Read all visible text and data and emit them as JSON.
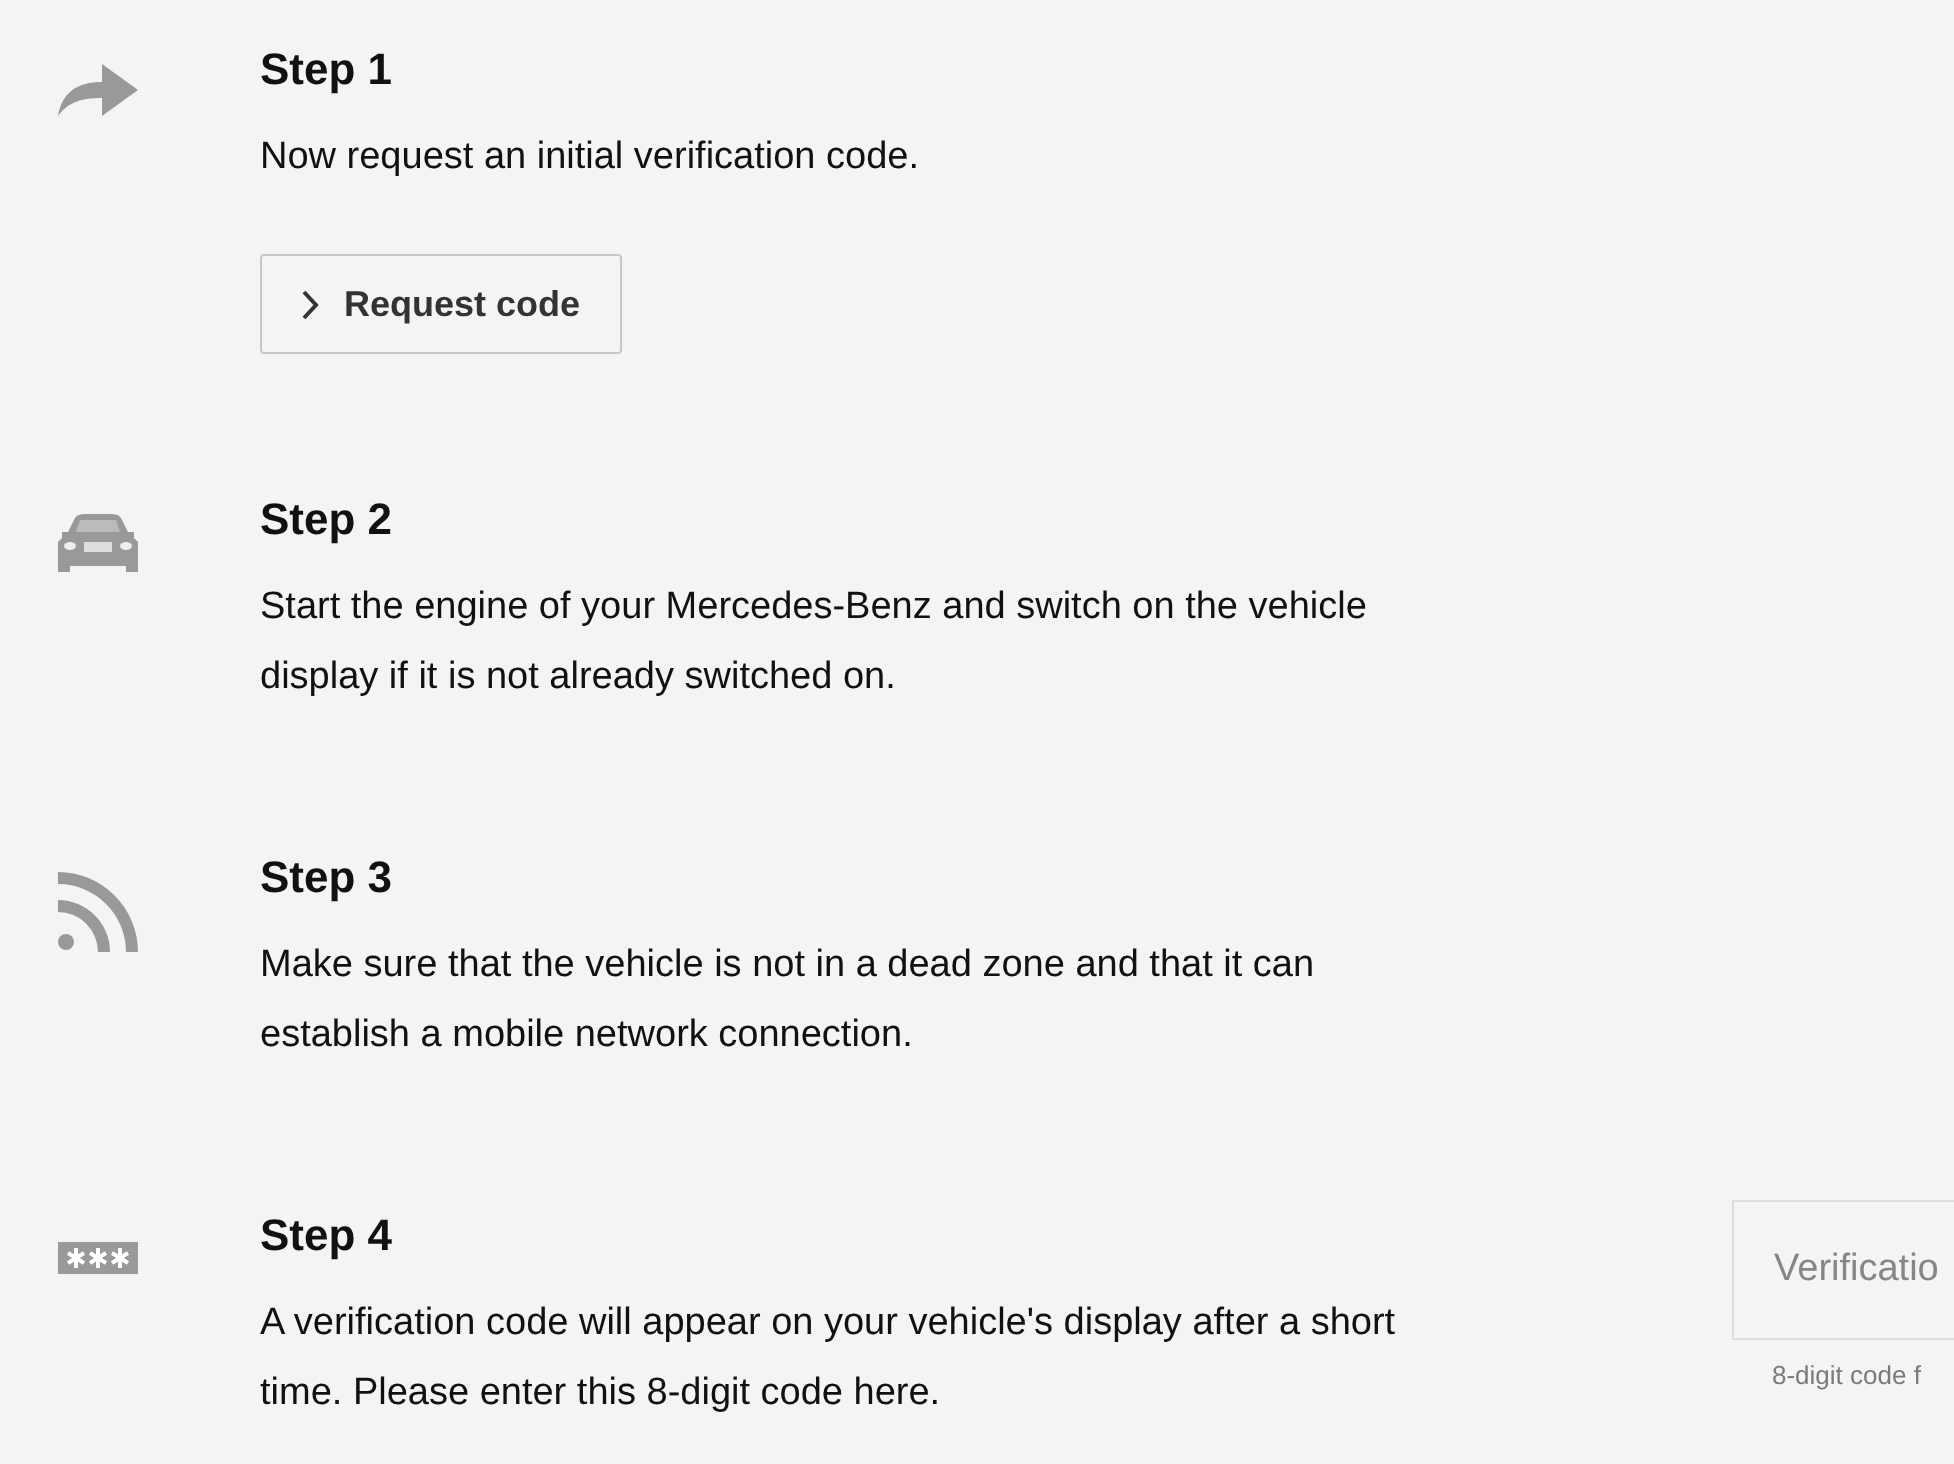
{
  "steps": [
    {
      "kind": "forward",
      "title": "Step 1",
      "text": "Now request an initial verification code.",
      "button": {
        "label": "Request code"
      }
    },
    {
      "kind": "car",
      "title": "Step 2",
      "text": "Start the engine of your Mercedes-Benz and switch on the vehicle display if it is not already switched on."
    },
    {
      "kind": "signal",
      "title": "Step 3",
      "text": "Make sure that the vehicle is not in a dead zone and that it can establish a mobile network connection."
    },
    {
      "kind": "password",
      "title": "Step 4",
      "text": "A verification code will appear on your vehicle's display after a short time. Please enter this 8-digit code here.",
      "field": {
        "placeholder": "Verificatio",
        "hint": "8-digit code f",
        "disabled": true
      }
    }
  ]
}
